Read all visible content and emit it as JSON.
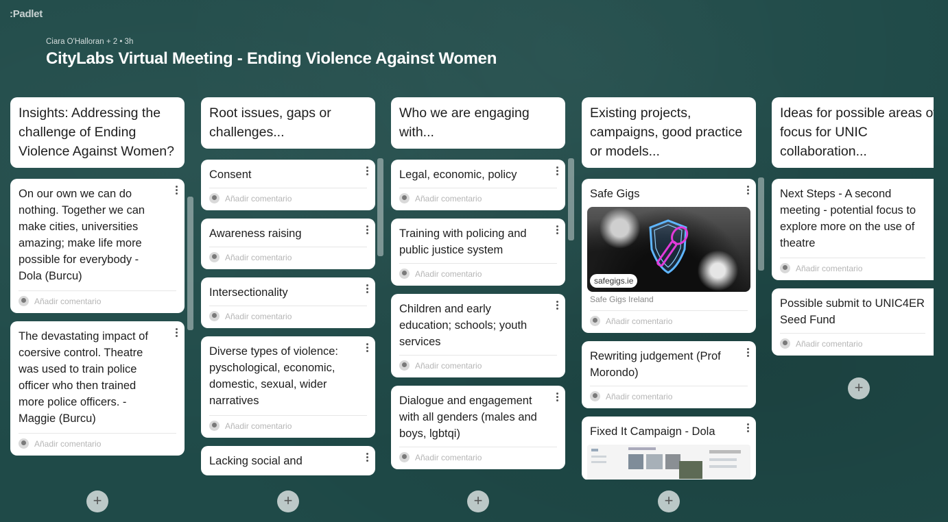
{
  "app": {
    "logo": ":Padlet"
  },
  "header": {
    "meta": "Ciara O'Halloran + 2 • 3h",
    "title": "CityLabs Virtual Meeting - Ending Violence Against Women"
  },
  "comment_placeholder": "Añadir comentario",
  "columns": [
    {
      "title": "Insights: Addressing the challenge of Ending Violence Against Women?",
      "posts": [
        {
          "text": "On our own we can do nothing. Together we can make cities, universities amazing; make life more possible for everybody - Dola (Burcu)"
        },
        {
          "text": "The devastating impact of coersive control. Theatre was used to train police officer who then trained more police officers. - Maggie (Burcu)"
        }
      ]
    },
    {
      "title": "Root issues, gaps or challenges...",
      "posts": [
        {
          "text": "Consent"
        },
        {
          "text": "Awareness raising"
        },
        {
          "text": "Intersectionality"
        },
        {
          "text": "Diverse types of violence: pyschological, economic, domestic, sexual, wider narratives"
        },
        {
          "text": "Lacking social and"
        }
      ]
    },
    {
      "title": "Who we are engaging with...",
      "posts": [
        {
          "text": "Legal, economic, policy"
        },
        {
          "text": "Training with policing and public justice system"
        },
        {
          "text": "Children and early education; schools; youth services"
        },
        {
          "text": "Dialogue and engagement with all genders (males and boys, lgbtqi)"
        }
      ]
    },
    {
      "title": "Existing projects, campaigns, good practice or models...",
      "posts": [
        {
          "text": "Safe Gigs",
          "link_domain": "safegigs.ie",
          "link_source": "Safe Gigs Ireland"
        },
        {
          "text": "Rewriting judgement (Prof Morondo)"
        },
        {
          "text": "Fixed It Campaign - Dola"
        }
      ]
    },
    {
      "title": "Ideas for possible areas of focus for UNIC collaboration...",
      "posts": [
        {
          "text": "Next Steps - A second meeting - potential focus to explore more on the use of theatre"
        },
        {
          "text": "Possible submit to UNIC4ER Seed Fund"
        }
      ]
    }
  ],
  "add_post_symbol": "+",
  "icons": {
    "kebab": "more-vertical-icon",
    "avatar": "user-avatar-icon",
    "add": "plus-icon"
  },
  "colors": {
    "background": "#1f4a48",
    "card": "#ffffff",
    "comment_text": "#b5b5b5"
  }
}
